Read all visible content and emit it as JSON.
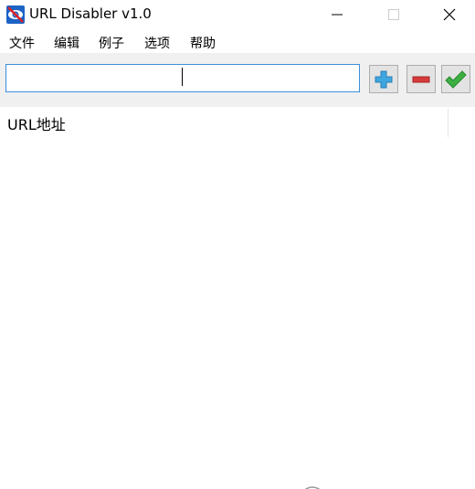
{
  "window": {
    "title": "URL Disabler v1.0",
    "controls": {
      "minimize": "minimize",
      "maximize": "maximize",
      "close": "close"
    }
  },
  "menu": {
    "items": [
      {
        "label": "文件"
      },
      {
        "label": "编辑"
      },
      {
        "label": "例子"
      },
      {
        "label": "选项"
      },
      {
        "label": "帮助"
      }
    ]
  },
  "toolbar": {
    "url_input_value": "",
    "buttons": {
      "add": "plus-icon",
      "remove": "minus-icon",
      "apply": "checkmark-icon"
    }
  },
  "list": {
    "columns": [
      {
        "label": "URL地址"
      }
    ],
    "rows": []
  },
  "colors": {
    "input_border": "#3c8fdc",
    "toolbar_bg": "#f0f0f0",
    "plus_blue": "#3ea6e0",
    "minus_red": "#d63a3a",
    "check_green": "#3cb043"
  }
}
